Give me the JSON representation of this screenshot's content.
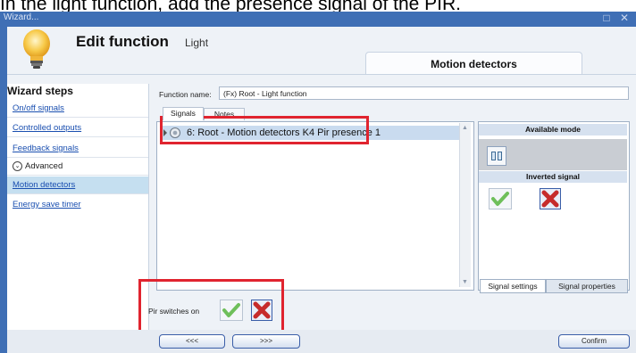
{
  "caption": "In the light function, add the presence signal of the PIR.",
  "window": {
    "title": "Wizard...",
    "controls": "□ ✕"
  },
  "header": {
    "title": "Edit function",
    "function_name": "Light",
    "tab_label": "Motion detectors"
  },
  "sidebar": {
    "title": "Wizard steps",
    "items": [
      {
        "label": "On/off signals"
      },
      {
        "label": "Controlled outputs"
      },
      {
        "label": "Feedback signals"
      },
      {
        "label": "Advanced"
      },
      {
        "label": "Motion detectors"
      },
      {
        "label": "Energy save timer"
      }
    ]
  },
  "form": {
    "function_name_label": "Function name:",
    "function_name_value": "(Fx) Root - Light function"
  },
  "tabs": [
    {
      "label": "Signals"
    },
    {
      "label": "Notes"
    }
  ],
  "signals": [
    {
      "label": "6: Root - Motion detectors K4 Pir presence 1"
    }
  ],
  "right_panel": {
    "available_mode_label": "Available mode",
    "inverted_signal_label": "Inverted signal",
    "tabs": [
      {
        "label": "Signal settings"
      },
      {
        "label": "Signal properties"
      }
    ]
  },
  "pir": {
    "label": "Pir switches on"
  },
  "footer": {
    "back_label": "<<<",
    "next_label": ">>>",
    "confirm_label": "Confirm"
  },
  "colors": {
    "titlebar": "#3f6fb5",
    "highlight_box": "#e0242f",
    "selected_row": "#c9dbef"
  }
}
